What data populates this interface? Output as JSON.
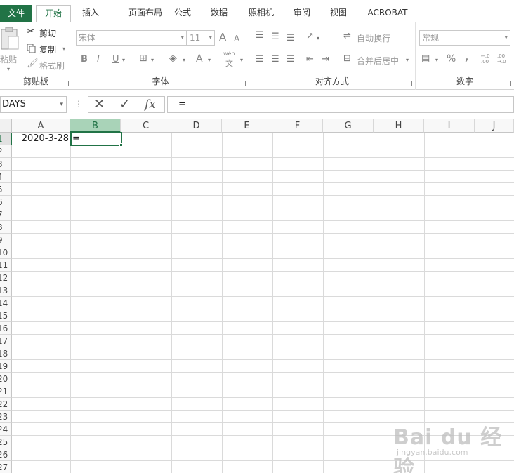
{
  "tabs": {
    "file": "文件",
    "home": "开始",
    "insert": "插入",
    "page_layout": "页面布局",
    "formulas": "公式",
    "data": "数据",
    "photo": "照相机",
    "review": "审阅",
    "view": "视图",
    "acrobat": "ACROBAT"
  },
  "clipboard": {
    "paste": "粘贴",
    "cut": "剪切",
    "copy": "复制",
    "format_painter": "格式刷",
    "label": "剪贴板"
  },
  "font": {
    "name": "宋体",
    "size": "11",
    "bold": "B",
    "italic": "I",
    "underline": "U",
    "increase": "A",
    "decrease": "A",
    "font_color": "A",
    "phonetic_top": "wén",
    "phonetic_bottom": "文",
    "label": "字体"
  },
  "alignment": {
    "wrap_text": "自动换行",
    "merge_center": "合并后居中",
    "label": "对齐方式"
  },
  "number": {
    "format": "常规",
    "percent": "%",
    "comma": ",",
    "increase_decimal": "←.0 .00",
    "decrease_decimal": ".00 →.0",
    "label": "数字"
  },
  "formula_bar": {
    "name_box": "DAYS",
    "cancel": "✕",
    "enter": "✓",
    "fx": "fx",
    "content": "="
  },
  "sheet": {
    "columns": [
      "A",
      "B",
      "C",
      "D",
      "E",
      "F",
      "G",
      "H",
      "I",
      "J"
    ],
    "rows": [
      "1",
      "2",
      "3",
      "4",
      "5",
      "6",
      "7",
      "8",
      "9",
      "10",
      "11",
      "12",
      "13",
      "14",
      "15",
      "16",
      "17",
      "18",
      "19",
      "20",
      "21",
      "22",
      "23",
      "24",
      "25",
      "26",
      "27"
    ],
    "cells": {
      "A1": "2020-3-28",
      "B1": "="
    },
    "active_cell": "B1"
  },
  "watermark": {
    "logo": "Bai du 经验",
    "url": "jingyan.baidu.com"
  },
  "colors": {
    "excel_green": "#217346",
    "selected_header": "#a9d3b8"
  }
}
